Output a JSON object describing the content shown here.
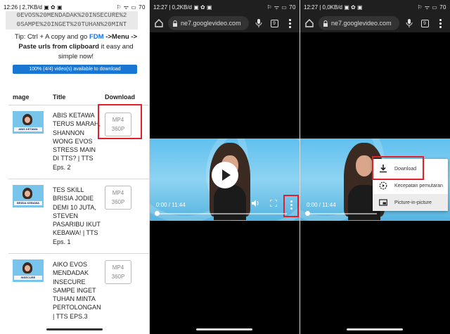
{
  "panel1": {
    "status": {
      "left": "12:26 | 2,7KB/d ▣ ✿ ▣",
      "right": "⚐ ᯤ ▭ 70"
    },
    "url_fragment": "0EVOS%20MENDADAK%20INSECURE%2\n0SAMPE%20INGET%20TUHAN%20MINT",
    "tip": {
      "pre": "Tip: Ctrl + A copy and go ",
      "fdm": "FDM",
      "menu": " ->Menu ->",
      "paste": "Paste urls from clipboard",
      "post": " it easy and simple now!"
    },
    "progress_label": "100% (4/4) video(s) available to download",
    "progress_fraction": 1.0,
    "columns": {
      "image": "mage",
      "title": "Title",
      "download": "Download"
    },
    "rows": [
      {
        "title": "ABIS KETAWA TERUS MARAH, SHANNON WONG EVOS STRESS MAIN DI TTS? | TTS Eps. 2",
        "format": "MP4",
        "quality": "360P",
        "thumb_caption": "ABIS KETAWA"
      },
      {
        "title": "TES SKILL BRISIA JODIE DEMI 10 JUTA, STEVEN PASARIBU IKUT KEBAWA! | TTS Eps. 1",
        "format": "MP4",
        "quality": "360P",
        "thumb_caption": "BRISIA KEBAWA"
      },
      {
        "title": "AIKO EVOS MENDADAK INSECURE SAMPE INGET TUHAN MINTA PERTOLONGAN | TTS EPS.3",
        "format": "MP4",
        "quality": "360P",
        "thumb_caption": "INSECURE"
      }
    ]
  },
  "panel2": {
    "status": {
      "left": "12:27 | 0,2KB/d ▣ ✿ ▣",
      "right": "⚐ ᯤ ▭ 70"
    },
    "address": "ne7.googlevideo.com",
    "tab_count": "9",
    "time": "0:00 / 11:44"
  },
  "panel3": {
    "status": {
      "left": "12:27 | 0,0KB/d ▣ ✿ ▣",
      "right": "⚐ ᯤ ▭ 70"
    },
    "address": "ne7.googlevideo.com",
    "tab_count": "9",
    "time": "0:00 / 11:44",
    "menu": [
      {
        "label": "Download",
        "icon": "download-icon"
      },
      {
        "label": "Kecepatan pemutaran",
        "icon": "speed-icon"
      },
      {
        "label": "Picture-in-picture",
        "icon": "pip-icon"
      }
    ]
  },
  "colors": {
    "highlight": "#e0202b",
    "progress": "#1976d2",
    "fdm_link": "#1a73e8"
  }
}
